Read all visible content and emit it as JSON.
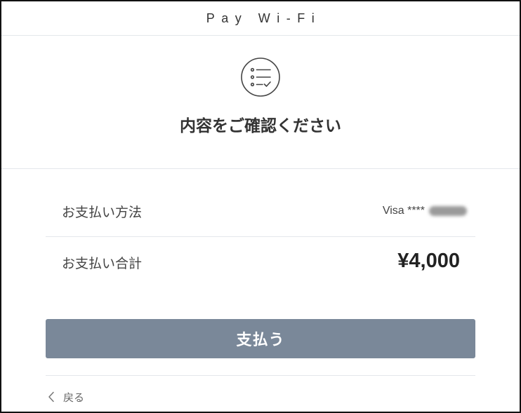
{
  "header": {
    "title": "Pay Wi-Fi"
  },
  "confirm": {
    "icon": "list-check-icon",
    "heading": "内容をご確認ください"
  },
  "details": {
    "payment_method": {
      "label": "お支払い方法",
      "value": "Visa ****"
    },
    "payment_total": {
      "label": "お支払い合計",
      "value": "¥4,000"
    }
  },
  "actions": {
    "pay_label": "支払う",
    "back_label": "戻る",
    "back_icon": "chevron-left-icon"
  },
  "colors": {
    "button": "#7a8899",
    "text": "#333333",
    "divider": "#e4e7eb",
    "frame": "#111111"
  }
}
